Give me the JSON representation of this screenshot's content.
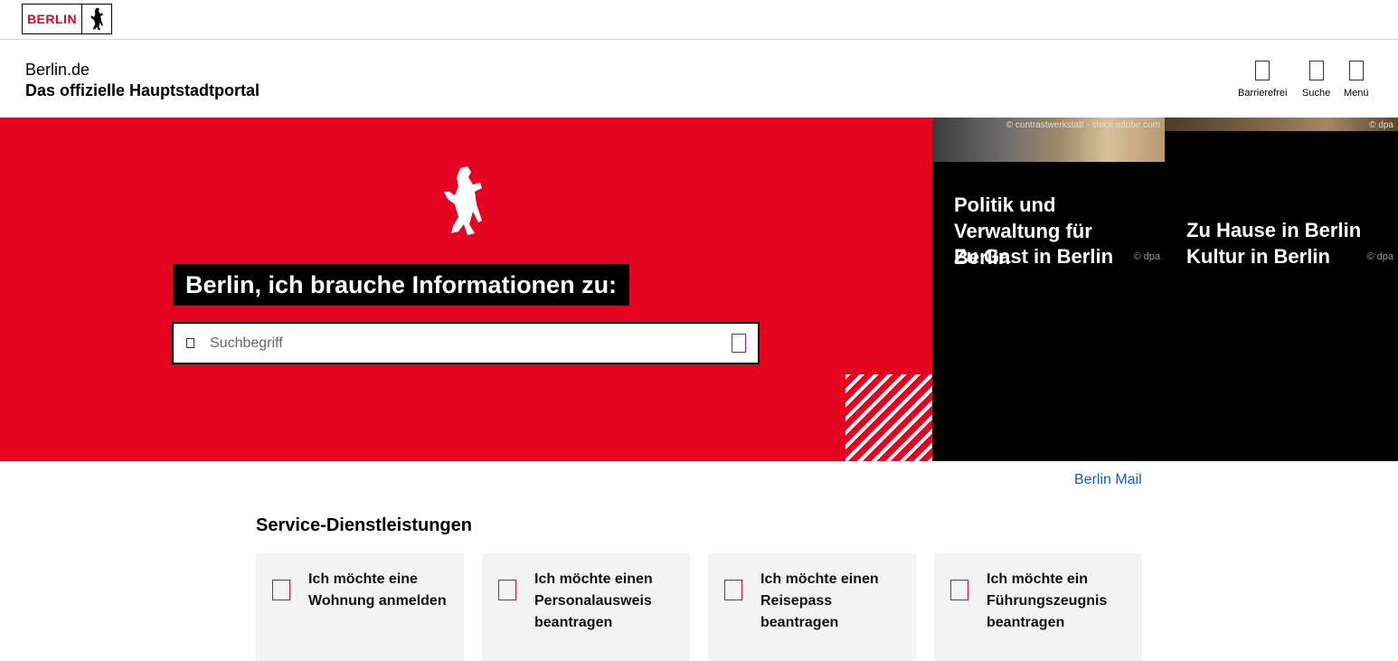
{
  "brand": {
    "logo_text": "BERLIN"
  },
  "header": {
    "portal_name": "Berlin.de",
    "tagline": "Das offizielle Hauptstadtportal",
    "tools": [
      {
        "label": "Barrierefrei",
        "icon": "accessibility-icon"
      },
      {
        "label": "Suche",
        "icon": "search-icon"
      },
      {
        "label": "Menü",
        "icon": "menu-icon"
      }
    ]
  },
  "hero": {
    "heading": "Berlin, ich brauche Informationen zu:",
    "search": {
      "placeholder": "Suchbegriff",
      "value": ""
    },
    "background_color": "#e40422"
  },
  "teasers": [
    {
      "credit_top": "© contrastwerkstatt - stock.adobe.com",
      "title": "Politik und Verwaltung für Berlin",
      "title_overlap": "Zu Gast in Berlin",
      "credit_side": "© dpa"
    },
    {
      "credit_top": "© dpa",
      "title": "Zu Hause in Berlin",
      "title_overlap": "Kultur in Berlin",
      "credit_side": "© dpa"
    }
  ],
  "links": {
    "mail": "Berlin Mail"
  },
  "services": {
    "title": "Service-Dienstleistungen",
    "items": [
      {
        "label": "Ich möchte eine Wohnung anmelden"
      },
      {
        "label": "Ich möchte einen Personalausweis beantragen"
      },
      {
        "label": "Ich möchte einen Reisepass beantragen"
      },
      {
        "label": "Ich möchte ein Führungszeugnis beantragen"
      }
    ]
  },
  "colors": {
    "accent": "#e40422",
    "link": "#1a58c6",
    "card_bg": "#f3f3f3"
  }
}
